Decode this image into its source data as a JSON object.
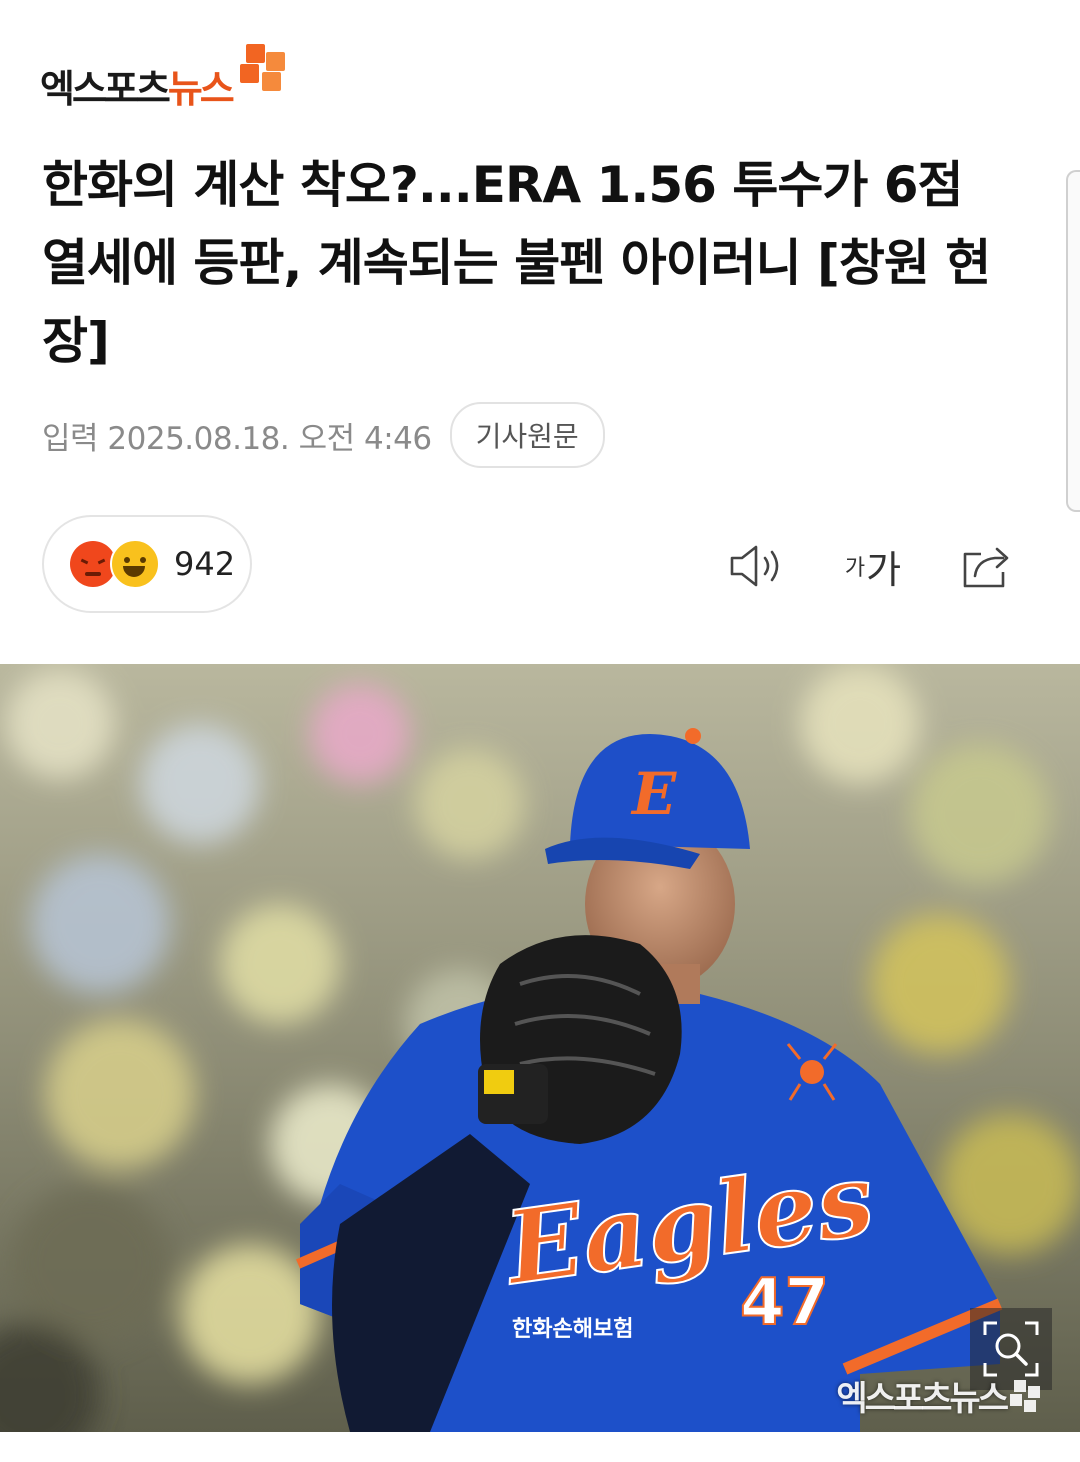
{
  "brand": {
    "name_part1": "엑스포츠",
    "name_part2": "뉴스",
    "accent_color": "#f26522"
  },
  "article": {
    "headline": "한화의 계산 착오?...ERA 1.56 투수가 6점 열세에 등판, 계속되는 불펜 아이러니 [창원 현장]",
    "published": "입력 2025.08.18. 오전 4:46",
    "original_button": "기사원문"
  },
  "reactions": {
    "count": "942",
    "icons": [
      "angry-face-icon",
      "laughing-face-icon"
    ]
  },
  "toolbar": {
    "listen_icon": "speaker-icon",
    "font_small": "가",
    "font_large": "가",
    "share_icon": "share-icon"
  },
  "photo": {
    "jersey_text": "Eagles",
    "jersey_number": "47",
    "cap_letter": "E",
    "sponsor": "한화손해보험",
    "watermark": "엑스포츠뉴스",
    "zoom_icon": "zoom-icon"
  }
}
